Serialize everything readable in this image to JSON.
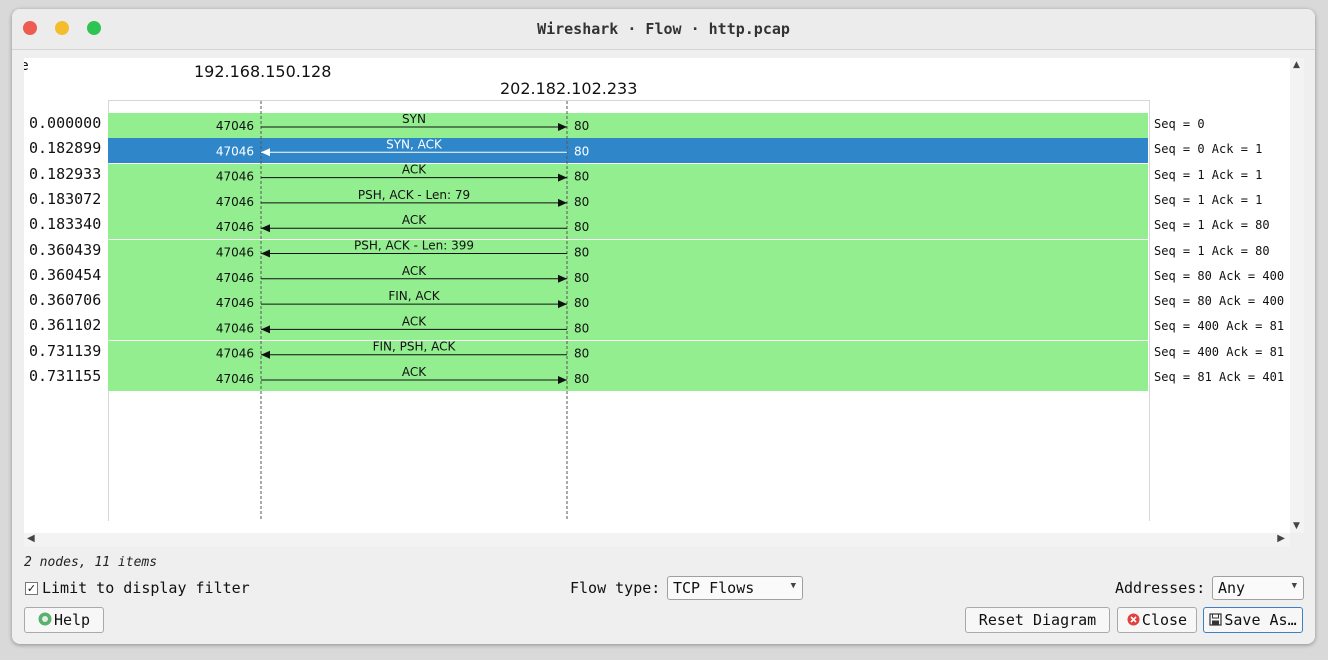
{
  "window": {
    "title": "Wireshark · Flow · http.pcap"
  },
  "diagram": {
    "cut_left_text": "e",
    "cut_right_text": "(",
    "node_a": "192.168.150.128",
    "node_b": "202.182.102.233",
    "colors": {
      "row": "#92ee8f",
      "selected": "#2f87c9"
    },
    "rows": [
      {
        "time": "0.000000",
        "src_port": "47046",
        "dst_port": "80",
        "label": "SYN",
        "direction": "right",
        "comment": "Seq = 0",
        "selected": false
      },
      {
        "time": "0.182899",
        "src_port": "47046",
        "dst_port": "80",
        "label": "SYN, ACK",
        "direction": "left",
        "comment": "Seq = 0 Ack = 1",
        "selected": true
      },
      {
        "time": "0.182933",
        "src_port": "47046",
        "dst_port": "80",
        "label": "ACK",
        "direction": "right",
        "comment": "Seq = 1 Ack = 1",
        "selected": false
      },
      {
        "time": "0.183072",
        "src_port": "47046",
        "dst_port": "80",
        "label": "PSH, ACK - Len: 79",
        "direction": "right",
        "comment": "Seq = 1 Ack = 1",
        "selected": false
      },
      {
        "time": "0.183340",
        "src_port": "47046",
        "dst_port": "80",
        "label": "ACK",
        "direction": "left",
        "comment": "Seq = 1 Ack = 80",
        "selected": false
      },
      {
        "time": "0.360439",
        "src_port": "47046",
        "dst_port": "80",
        "label": "PSH, ACK - Len: 399",
        "direction": "left",
        "comment": "Seq = 1 Ack = 80",
        "selected": false
      },
      {
        "time": "0.360454",
        "src_port": "47046",
        "dst_port": "80",
        "label": "ACK",
        "direction": "right",
        "comment": "Seq = 80 Ack = 400",
        "selected": false
      },
      {
        "time": "0.360706",
        "src_port": "47046",
        "dst_port": "80",
        "label": "FIN, ACK",
        "direction": "right",
        "comment": "Seq = 80 Ack = 400",
        "selected": false
      },
      {
        "time": "0.361102",
        "src_port": "47046",
        "dst_port": "80",
        "label": "ACK",
        "direction": "left",
        "comment": "Seq = 400 Ack = 81",
        "selected": false
      },
      {
        "time": "0.731139",
        "src_port": "47046",
        "dst_port": "80",
        "label": "FIN, PSH, ACK",
        "direction": "left",
        "comment": "Seq = 400 Ack = 81",
        "selected": false
      },
      {
        "time": "0.731155",
        "src_port": "47046",
        "dst_port": "80",
        "label": "ACK",
        "direction": "right",
        "comment": "Seq = 81 Ack = 401",
        "selected": false
      }
    ]
  },
  "status": {
    "text": "2 nodes, 11 items"
  },
  "controls": {
    "limit_label": "Limit to display filter",
    "limit_checked_mark": "✓",
    "flow_type_label": "Flow type:",
    "flow_type_value": "TCP Flows",
    "addresses_label": "Addresses:",
    "addresses_value": "Any"
  },
  "buttons": {
    "help": "Help",
    "reset": "Reset Diagram",
    "close": "Close",
    "save": "Save As…"
  },
  "icons": {
    "help": "help-circle-icon",
    "close": "close-circle-icon",
    "save": "save-disk-icon"
  }
}
